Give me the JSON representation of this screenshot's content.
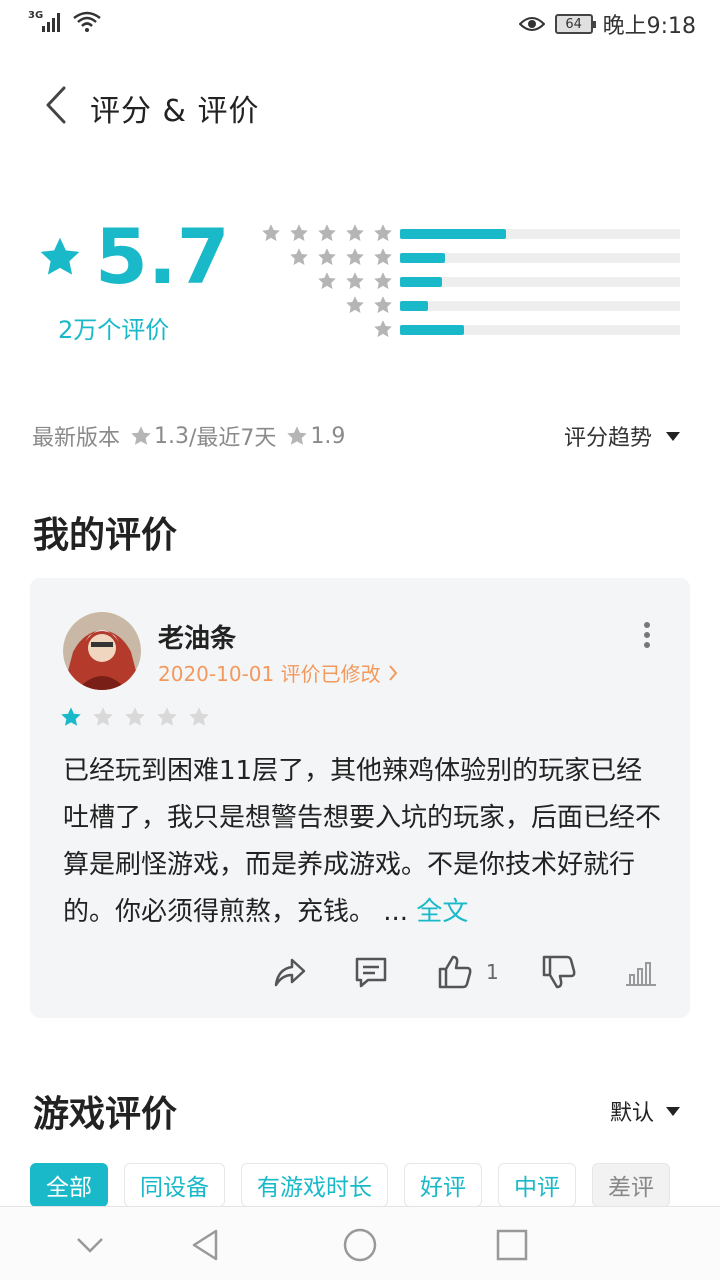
{
  "status_bar": {
    "network": "3G",
    "battery": "64",
    "time": "晚上9:18"
  },
  "header": {
    "title": "评分 & 评价"
  },
  "summary": {
    "score": "5.7",
    "count": "2万个评价",
    "accent_color": "#19b9c9",
    "distribution": [
      {
        "stars": 5,
        "fraction": 0.38
      },
      {
        "stars": 4,
        "fraction": 0.16
      },
      {
        "stars": 3,
        "fraction": 0.15
      },
      {
        "stars": 2,
        "fraction": 0.1
      },
      {
        "stars": 1,
        "fraction": 0.23
      }
    ]
  },
  "version": {
    "latest_label": "最新版本",
    "latest_score": "1.3",
    "recent_label": "/最近7天",
    "recent_score": "1.9",
    "trend_label": "评分趋势"
  },
  "my_review": {
    "section_title": "我的评价",
    "username": "老油条",
    "meta": "2020-10-01 评价已修改",
    "rating": 1,
    "text": "已经玩到困难11层了，其他辣鸡体验别的玩家已经吐槽了，我只是想警告想要入坑的玩家，后面已经不算是刷怪游戏，而是养成游戏。不是你技术好就行的。你必须得煎熬，充钱。 ... ",
    "full_text_link": "全文",
    "like_count": "1",
    "meta_color": "#f29a5e"
  },
  "game_reviews": {
    "section_title": "游戏评价",
    "sort_label": "默认",
    "filters": [
      "全部",
      "同设备",
      "有游戏时长",
      "好评",
      "中评",
      "差评"
    ]
  }
}
